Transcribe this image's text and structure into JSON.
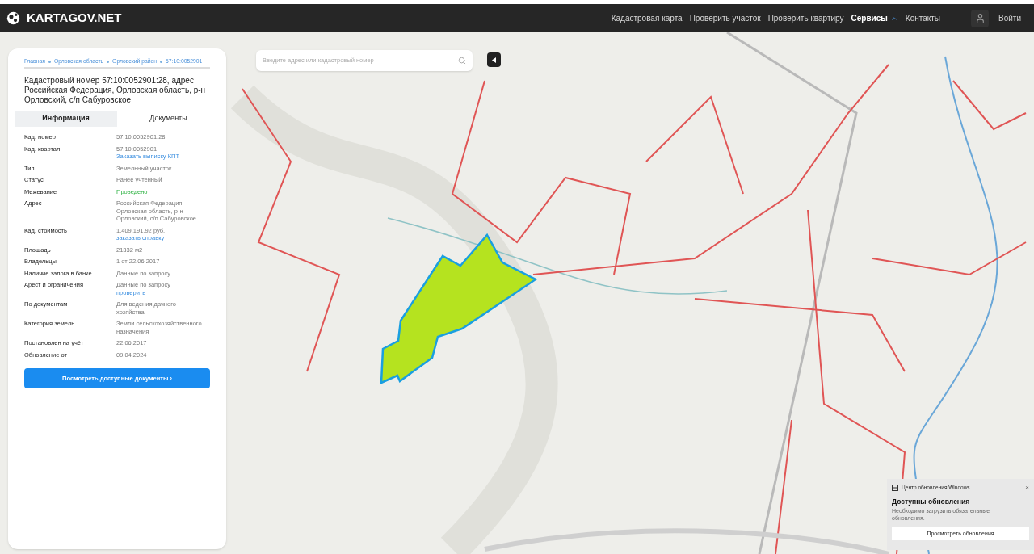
{
  "header": {
    "logo": "KARTAGOV.NET",
    "nav": [
      {
        "label": "Кадастровая карта",
        "selected": false
      },
      {
        "label": "Проверить участок",
        "selected": false
      },
      {
        "label": "Проверить квартиру",
        "selected": false
      },
      {
        "label": "Сервисы",
        "selected": true,
        "dropdown": true
      },
      {
        "label": "Контакты",
        "selected": false
      }
    ],
    "login": "Войти"
  },
  "search": {
    "placeholder": "Введите адрес или кадастровый номер"
  },
  "panel": {
    "breadcrumbs": [
      "Главная",
      "Орловская область",
      "Орловский район",
      "57:10:0052901"
    ],
    "title": "Кадастровый номер 57:10:0052901:28, адрес Российская Федерация, Орловская область, р-н Орловский, с/п Сабуровское",
    "tabs": [
      {
        "label": "Информация",
        "selected": true
      },
      {
        "label": "Документы",
        "selected": false
      }
    ],
    "rows": [
      {
        "label": "Кад. номер",
        "value": "57:10:0052901:28"
      },
      {
        "label": "Кад. квартал",
        "value": "57:10:0052901",
        "link": "Заказать выписку КПТ"
      },
      {
        "label": "Тип",
        "value": "Земельный участок"
      },
      {
        "label": "Статус",
        "value": "Ранее учтенный"
      },
      {
        "label": "Межевание",
        "value": "Проведено",
        "kind": "success"
      },
      {
        "label": "Адрес",
        "value": "Российская Федерация, Орловская область, р-н Орловский, с/п Сабуровское"
      },
      {
        "label": "Кад. стоимость",
        "value": "1,409,191.92 руб.",
        "link": "заказать справку"
      },
      {
        "label": "Площадь",
        "value": "21332 м2"
      },
      {
        "label": "Владельцы",
        "value": "1 от 22.06.2017"
      },
      {
        "label": "Наличие залога в банке",
        "value": "Данные по запросу"
      },
      {
        "label": "Арест и ограничения",
        "value": "Данные по запросу",
        "link": "проверить"
      },
      {
        "label": "По документам",
        "value": "Для ведения дачного хозяйства"
      },
      {
        "label": "Категория земель",
        "value": "Земли сельскохозяйственного назначения"
      },
      {
        "label": "Постановлен на учёт",
        "value": "22.06.2017"
      },
      {
        "label": "Обновление от",
        "value": "09.04.2024"
      }
    ],
    "button": "Посмотреть доступные документы ›"
  },
  "notification": {
    "app": "Центр обновления Windows",
    "close": "×",
    "title": "Доступны обновления",
    "text": "Необходимо загрузить обязательные обновления.",
    "button": "Просмотреть обновления"
  }
}
